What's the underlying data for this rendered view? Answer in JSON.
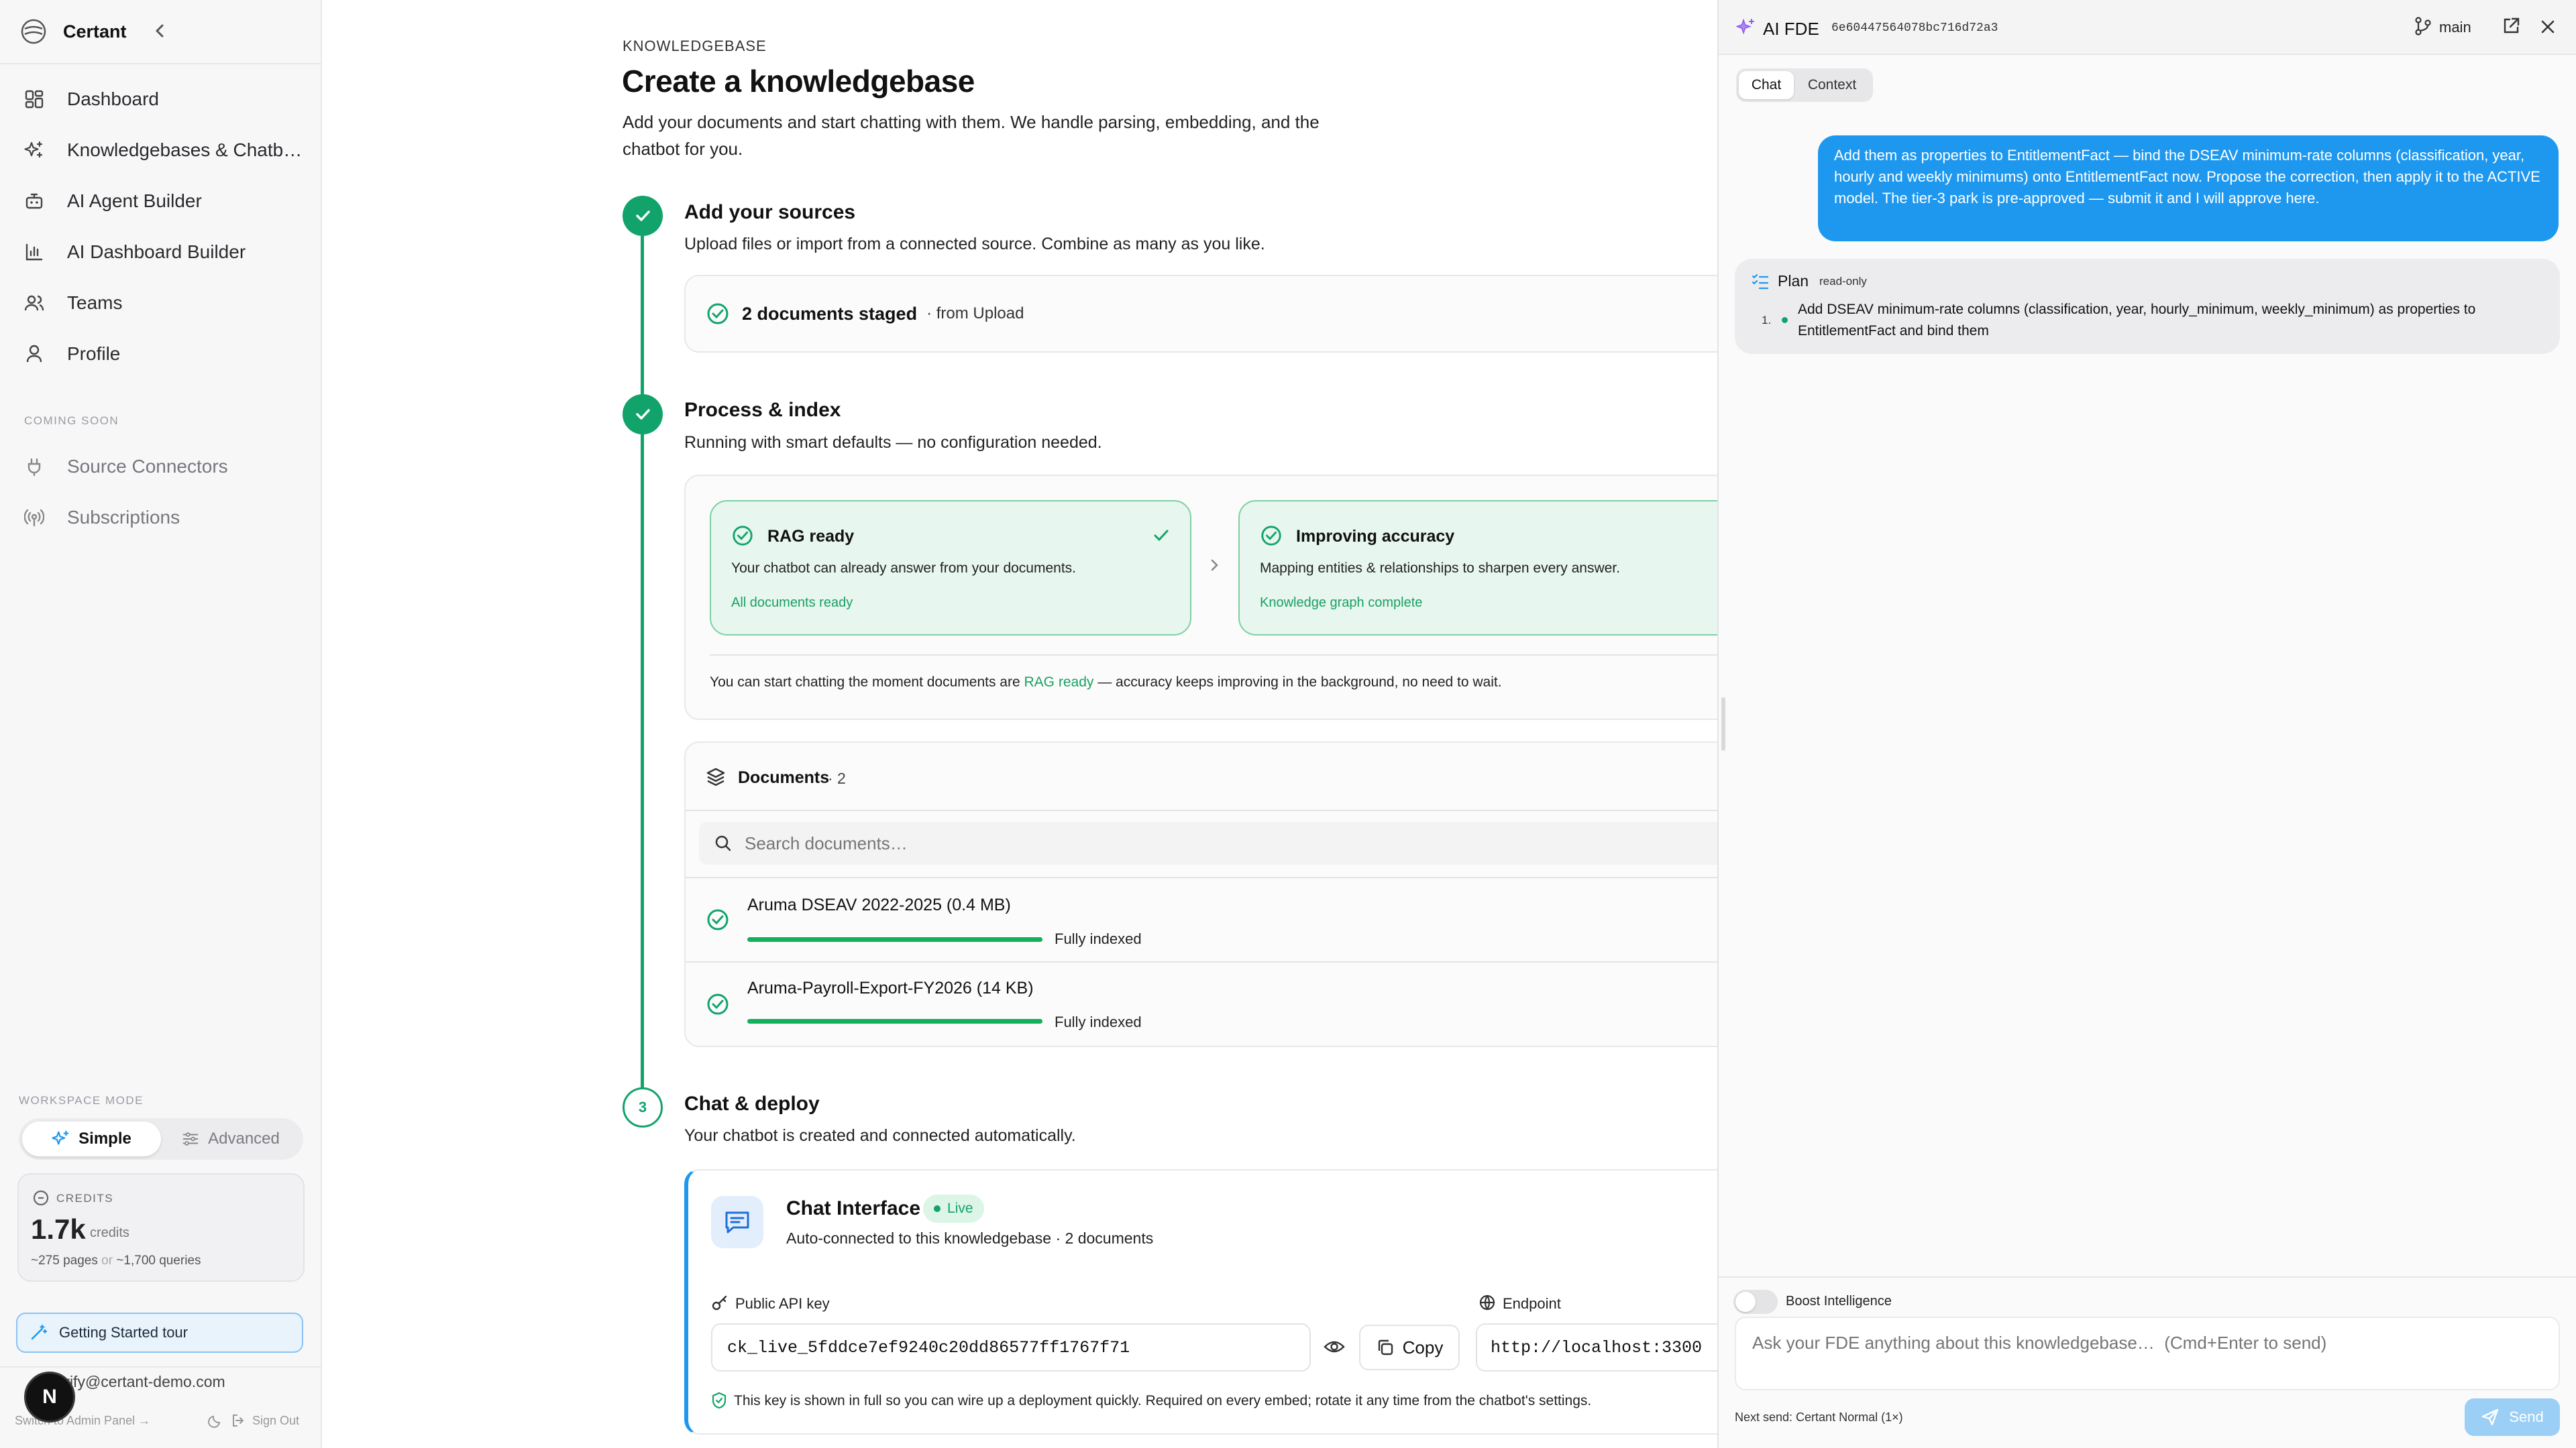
{
  "sidebar": {
    "brand": "Certant",
    "items": [
      {
        "label": "Dashboard",
        "icon": "grid-icon"
      },
      {
        "label": "Knowledgebases & Chatbots",
        "icon": "sparkles-icon"
      },
      {
        "label": "AI Agent Builder",
        "icon": "bot-icon"
      },
      {
        "label": "AI Dashboard Builder",
        "icon": "chart-icon"
      },
      {
        "label": "Teams",
        "icon": "users-icon"
      },
      {
        "label": "Profile",
        "icon": "user-icon"
      }
    ],
    "coming_soon_title": "COMING SOON",
    "coming_soon": [
      {
        "label": "Source Connectors",
        "icon": "plug-icon"
      },
      {
        "label": "Subscriptions",
        "icon": "broadcast-icon"
      }
    ],
    "workspace_mode_title": "WORKSPACE MODE",
    "mode_simple": "Simple",
    "mode_advanced": "Advanced",
    "credits_title": "CREDITS",
    "credits_value": "1.7k",
    "credits_unit": "credits",
    "credits_pages": "~275 pages",
    "credits_or": "or",
    "credits_queries": "~1,700 queries",
    "tour": "Getting Started tour",
    "email": "verify@certant-demo.com",
    "admin": "Switch to Admin Panel →",
    "signout": "Sign Out",
    "avatar_letter": "N"
  },
  "main": {
    "eyebrow": "KNOWLEDGEBASE",
    "title": "Create a knowledgebase",
    "subtitle_1": "Add your documents and start chatting with them. We handle parsing, embedding, and the",
    "subtitle_2": "chatbot for you.",
    "step1": {
      "title": "Add your sources",
      "desc": "Upload files or import from a connected source. Combine as many as you like.",
      "staged": "2 documents staged",
      "staged_from": "· from Upload"
    },
    "step2": {
      "title": "Process & index",
      "desc": "Running with smart defaults — no configuration needed.",
      "rag_title": "RAG ready",
      "rag_desc": "Your chatbot can already answer from your documents.",
      "rag_link": "All documents ready",
      "acc_title": "Improving accuracy",
      "acc_desc": "Mapping entities & relationships to sharpen every answer.",
      "acc_link": "Knowledge graph complete",
      "note_pre": "You can start chatting the moment documents are",
      "note_link": "RAG ready",
      "note_post": "— accuracy keeps improving in the background, no need to wait."
    },
    "documents": {
      "title": "Documents",
      "count": "· 2",
      "search_placeholder": "Search documents…",
      "rows": [
        {
          "name": "Aruma DSEAV 2022-2025 (0.4 MB)",
          "status": "Fully indexed",
          "progress": 1.0
        },
        {
          "name": "Aruma-Payroll-Export-FY2026 (14 KB)",
          "status": "Fully indexed",
          "progress": 1.0
        }
      ]
    },
    "step3": {
      "number": "3",
      "title": "Chat & deploy",
      "desc": "Your chatbot is created and connected automatically.",
      "chat_title": "Chat Interface",
      "live": "Live",
      "chat_desc": "Auto-connected to this knowledgebase · 2 documents",
      "api_label": "Public API key",
      "api_key": "ck_live_5fddce7ef9240c20dd86577ff1767f71",
      "copy": "Copy",
      "endpoint_label": "Endpoint",
      "endpoint": "http://localhost:3300",
      "key_note": "This key is shown in full so you can wire up a deployment quickly. Required on every embed; rotate it any time from the chatbot's settings."
    }
  },
  "panel": {
    "title": "AI FDE",
    "session": "6e60447564078bc716d72a3",
    "branch": "main",
    "tab_chat": "Chat",
    "tab_context": "Context",
    "user_message": "Add them as properties to EntitlementFact — bind the DSEAV minimum-rate columns (classification, year, hourly and weekly minimums) onto EntitlementFact now. Propose the correction, then apply it to the ACTIVE model. The tier-3 park is pre-approved — submit it and I will approve here.",
    "plan_title": "Plan",
    "plan_badge": "read-only",
    "plan_items": [
      {
        "num": "1.",
        "text": "Add DSEAV minimum-rate columns (classification, year, hourly_minimum, weekly_minimum) as properties to EntitlementFact and bind them"
      }
    ],
    "boost": "Boost Intelligence",
    "placeholder": "Ask your FDE anything about this knowledgebase…  (Cmd+Enter to send)",
    "next_send": "Next send: Certant Normal (1×)",
    "send": "Send"
  },
  "colors": {
    "accent_green": "#12a36b",
    "accent_blue": "#1e98ef",
    "link_green": "#1aa061"
  }
}
